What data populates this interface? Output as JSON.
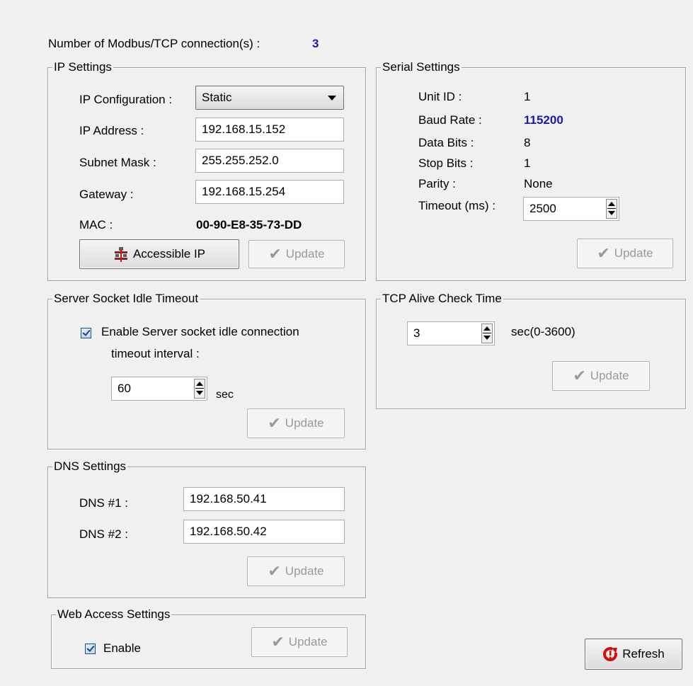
{
  "header": {
    "connections_label": "Number of Modbus/TCP connection(s) :",
    "connections_value": "3"
  },
  "ip_settings": {
    "title": "IP Settings",
    "config_label": "IP Configuration :",
    "config_value": "Static",
    "ip_label": "IP Address :",
    "ip_value": "192.168.15.152",
    "subnet_label": "Subnet Mask :",
    "subnet_value": "255.255.252.0",
    "gateway_label": "Gateway :",
    "gateway_value": "192.168.15.254",
    "mac_label": "MAC :",
    "mac_value": "00-90-E8-35-73-DD",
    "accessible_ip_label": "Accessible IP",
    "update_label": "Update"
  },
  "serial_settings": {
    "title": "Serial Settings",
    "unit_id_label": "Unit ID :",
    "unit_id_value": "1",
    "baud_label": "Baud Rate :",
    "baud_value": "115200",
    "data_bits_label": "Data Bits :",
    "data_bits_value": "8",
    "stop_bits_label": "Stop Bits :",
    "stop_bits_value": "1",
    "parity_label": "Parity :",
    "parity_value": "None",
    "timeout_label": "Timeout (ms) :",
    "timeout_value": "2500",
    "update_label": "Update"
  },
  "socket_timeout": {
    "title": "Server Socket Idle Timeout",
    "enable_label_line1": "Enable Server socket idle connection",
    "enable_label_line2": "timeout interval :",
    "enabled": true,
    "value": "60",
    "unit": "sec",
    "update_label": "Update"
  },
  "tcp_alive": {
    "title": "TCP Alive Check Time",
    "value": "3",
    "unit": "sec(0-3600)",
    "update_label": "Update"
  },
  "dns_settings": {
    "title": "DNS Settings",
    "dns1_label": "DNS  #1 :",
    "dns1_value": "192.168.50.41",
    "dns2_label": "DNS  #2 :",
    "dns2_value": "192.168.50.42",
    "update_label": "Update"
  },
  "web_access": {
    "title": "Web Access Settings",
    "enable_label": "Enable",
    "enabled": true,
    "update_label": "Update"
  },
  "refresh_label": "Refresh",
  "colors": {
    "accent_value": "#1a1aa6",
    "refresh_icon": "#cc1111"
  }
}
